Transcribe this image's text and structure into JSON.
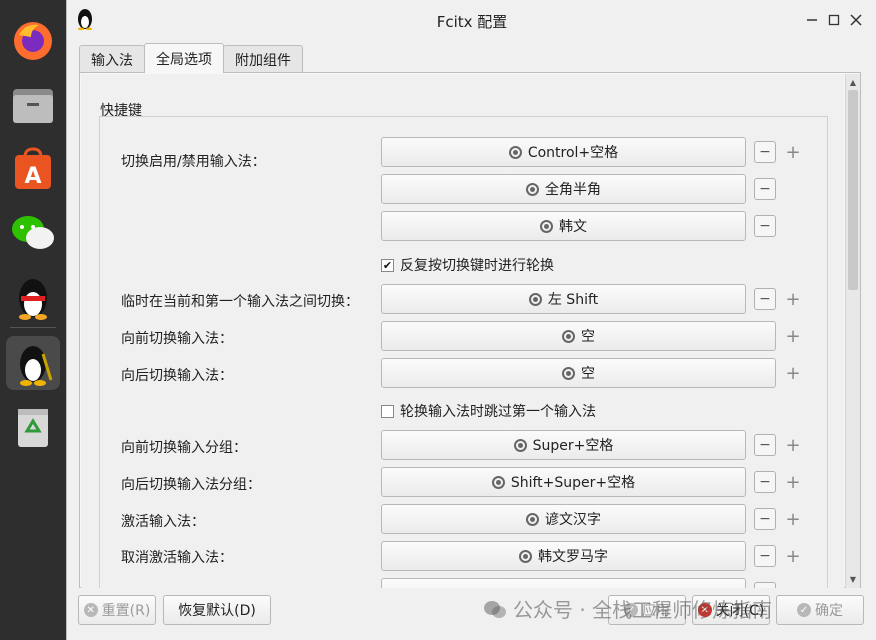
{
  "window": {
    "title": "Fcitx 配置"
  },
  "tabs": [
    {
      "label": "输入法"
    },
    {
      "label": "全局选项"
    },
    {
      "label": "附加组件"
    }
  ],
  "group": {
    "title": "快捷键"
  },
  "rows": {
    "toggle_label": "切换启用/禁用输入法：",
    "toggle_keys": [
      "Control+空格",
      "全角半角",
      "韩文"
    ],
    "repeat_checkbox": {
      "label": "反复按切换键时进行轮换",
      "checked": true
    },
    "temp_switch_label": "临时在当前和第一个输入法之间切换：",
    "temp_switch_key": "左 Shift",
    "forward_label": "向前切换输入法：",
    "forward_key": "空",
    "backward_label": "向后切换输入法：",
    "backward_key": "空",
    "skip_checkbox": {
      "label": "轮换输入法时跳过第一个输入法",
      "checked": false
    },
    "forward_group_label": "向前切换输入分组：",
    "forward_group_key": "Super+空格",
    "backward_group_label": "向后切换输入法分组：",
    "backward_group_key": "Shift+Super+空格",
    "activate_label": "激活输入法：",
    "activate_key": "谚文汉字",
    "deactivate_label": "取消激活输入法：",
    "deactivate_key": "韩文罗马字"
  },
  "bottom": {
    "reset": "重置(R)",
    "restore": "恢复默认(D)",
    "apply": "应用",
    "close": "关闭(C)",
    "ok": "确定"
  },
  "watermark": "公众号 · 全栈工程师修炼指南",
  "colors": {
    "dock_bg": "#2e2e2e",
    "window_bg": "#f0f0f0",
    "close_red": "#d6342c"
  }
}
